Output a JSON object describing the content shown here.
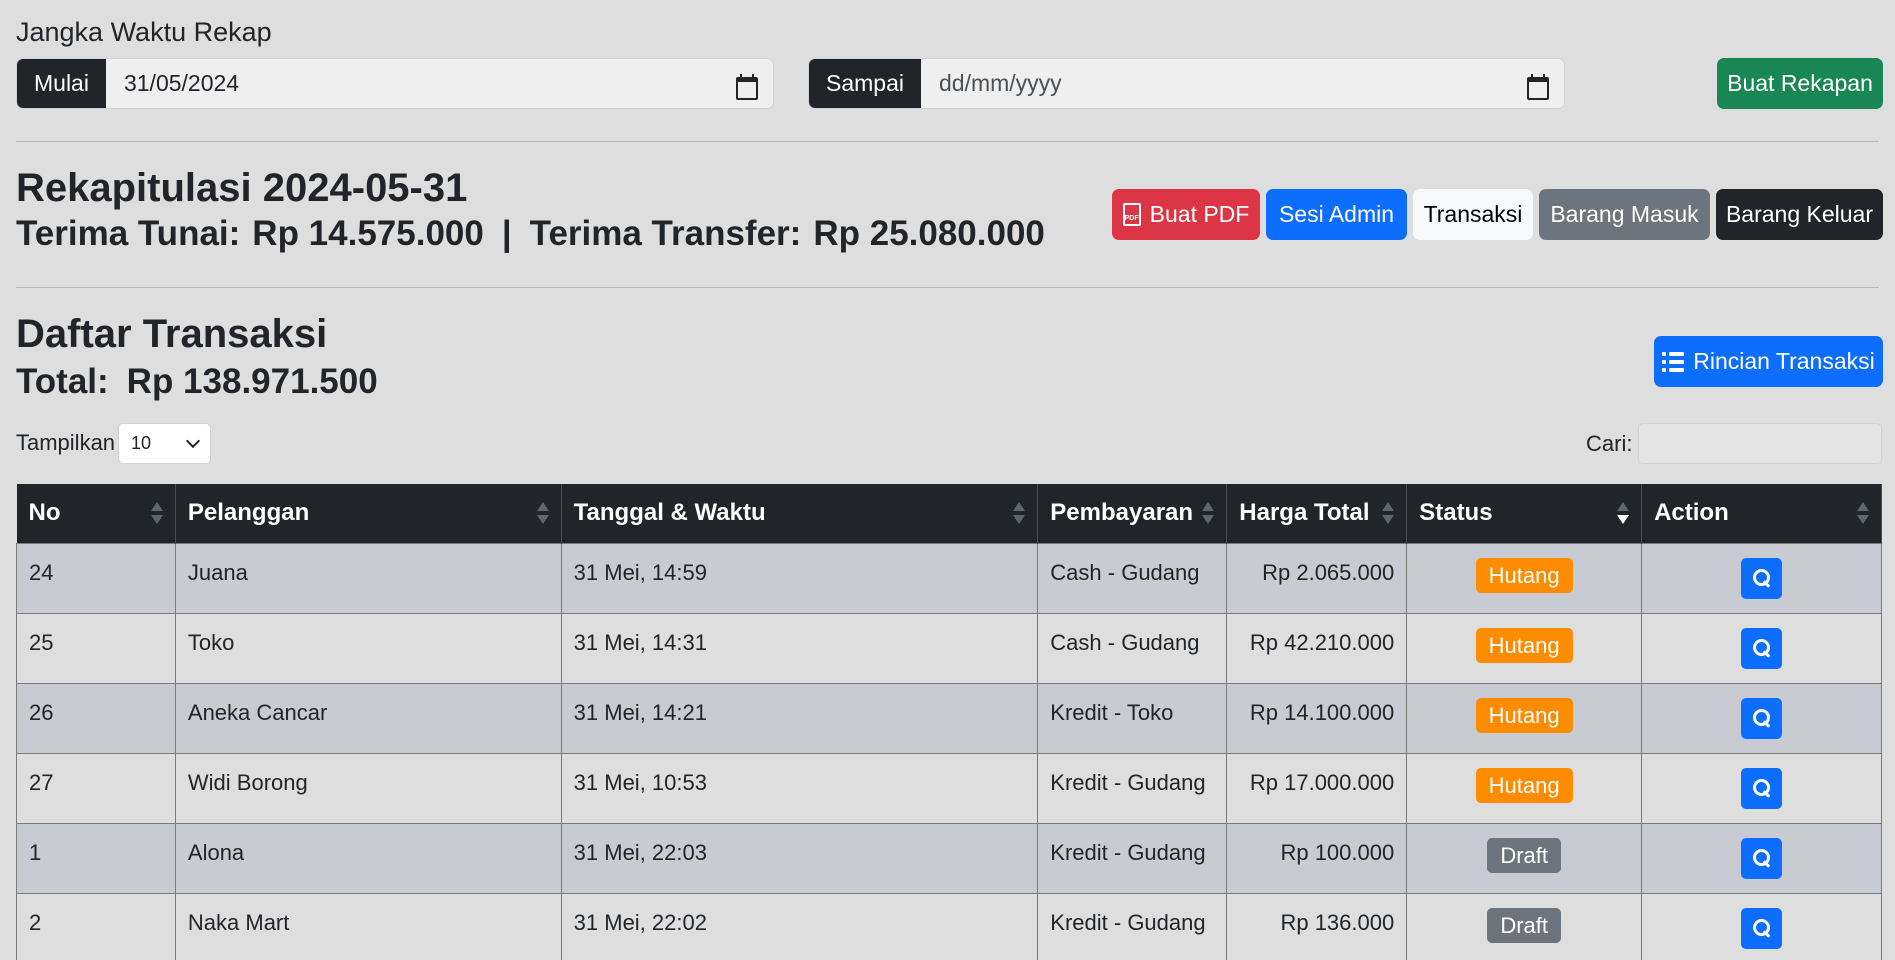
{
  "range": {
    "title": "Jangka Waktu Rekap",
    "start_label": "Mulai",
    "start_value": "31/05/2024",
    "end_label": "Sampai",
    "end_placeholder": "dd/mm/yyyy",
    "submit_label": "Buat Rekapan"
  },
  "recap": {
    "title": "Rekapitulasi 2024-05-31",
    "cash_label": "Terima Tunai:",
    "cash_value": "Rp 14.575.000",
    "separator": "|",
    "transfer_label": "Terima Transfer:",
    "transfer_value": "Rp 25.080.000",
    "buttons": {
      "pdf": "Buat PDF",
      "admin": "Sesi Admin",
      "transaksi": "Transaksi",
      "masuk": "Barang Masuk",
      "keluar": "Barang Keluar"
    }
  },
  "list": {
    "title": "Daftar Transaksi",
    "total_label": "Total:",
    "total_value": "Rp 138.971.500",
    "detail_button": "Rincian Transaksi",
    "show_label": "Tampilkan",
    "show_value": "10",
    "search_label": "Cari:"
  },
  "table": {
    "headers": [
      "No",
      "Pelanggan",
      "Tanggal & Waktu",
      "Pembayaran",
      "Harga Total",
      "Status",
      "Action"
    ],
    "rows": [
      {
        "no": "24",
        "customer": "Juana",
        "datetime": "31 Mei, 14:59",
        "payment": "Cash - Gudang",
        "total": "Rp 2.065.000",
        "status": "Hutang"
      },
      {
        "no": "25",
        "customer": "Toko",
        "datetime": "31 Mei, 14:31",
        "payment": "Cash - Gudang",
        "total": "Rp 42.210.000",
        "status": "Hutang"
      },
      {
        "no": "26",
        "customer": "Aneka Cancar",
        "datetime": "31 Mei, 14:21",
        "payment": "Kredit - Toko",
        "total": "Rp 14.100.000",
        "status": "Hutang"
      },
      {
        "no": "27",
        "customer": "Widi Borong",
        "datetime": "31 Mei, 10:53",
        "payment": "Kredit - Gudang",
        "total": "Rp 17.000.000",
        "status": "Hutang"
      },
      {
        "no": "1",
        "customer": "Alona",
        "datetime": "31 Mei, 22:03",
        "payment": "Kredit - Gudang",
        "total": "Rp 100.000",
        "status": "Draft"
      },
      {
        "no": "2",
        "customer": "Naka Mart",
        "datetime": "31 Mei, 22:02",
        "payment": "Kredit - Gudang",
        "total": "Rp 136.000",
        "status": "Draft"
      }
    ]
  },
  "colors": {
    "status_hutang": "#fd8c00",
    "status_draft": "#6c757d",
    "primary": "#0d6efd"
  },
  "icons": {
    "calendar": "calendar-icon",
    "pdf": "file-pdf-icon",
    "list": "list-icon",
    "search": "search-icon",
    "sort": "sort-icon"
  }
}
